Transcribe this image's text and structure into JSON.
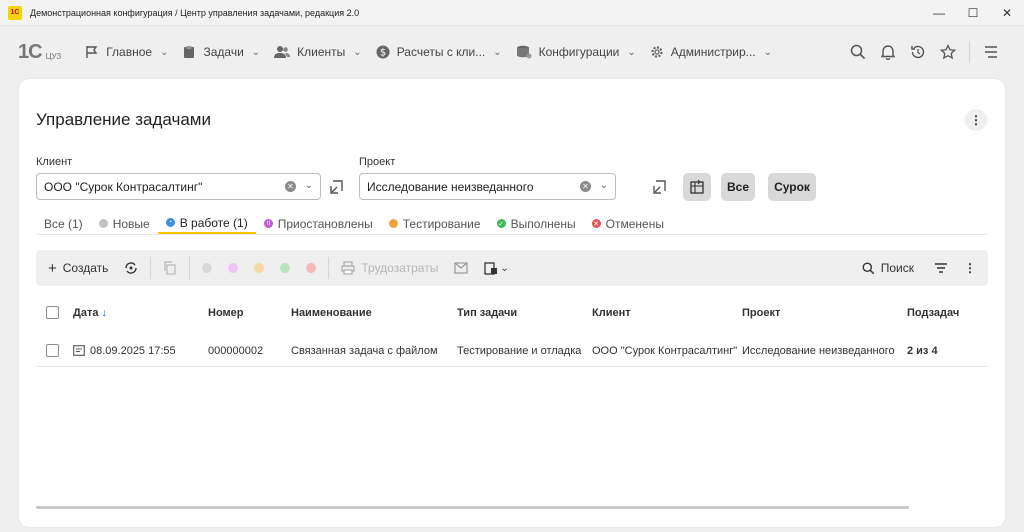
{
  "window": {
    "app_icon_text": "1С",
    "title": "Демонстрационная конфигурация / Центр управления задачами, редакция 2.0",
    "minimize": "—",
    "maximize": "☐",
    "close": "✕"
  },
  "logo": {
    "big": "1С",
    "small": "ЦУЗ"
  },
  "nav": {
    "items": [
      {
        "label": "Главное",
        "icon": "flag-icon"
      },
      {
        "label": "Задачи",
        "icon": "clipboard-icon"
      },
      {
        "label": "Клиенты",
        "icon": "users-icon"
      },
      {
        "label": "Расчеты с кли...",
        "icon": "dollar-icon"
      },
      {
        "label": "Конфигурации",
        "icon": "database-icon"
      },
      {
        "label": "Администрир...",
        "icon": "gear-icon"
      }
    ]
  },
  "page": {
    "title": "Управление задачами",
    "client_label": "Клиент",
    "client_value": "ООО \"Сурок Контрасалтинг\"",
    "project_label": "Проект",
    "project_value": "Исследование неизведанного",
    "btn_all": "Все",
    "btn_surok": "Сурок"
  },
  "tabs": [
    {
      "label": "Все (1)",
      "color": ""
    },
    {
      "label": "Новые",
      "color": "#c2c2c2"
    },
    {
      "label": "В работе (1)",
      "color": "#3d8fe0"
    },
    {
      "label": "Приостановлены",
      "color": "#c05ad6"
    },
    {
      "label": "Тестирование",
      "color": "#f2a23a"
    },
    {
      "label": "Выполнены",
      "color": "#3cba54"
    },
    {
      "label": "Отменены",
      "color": "#e05555"
    }
  ],
  "toolbar": {
    "create": "Создать",
    "effort": "Трудозатраты",
    "search": "Поиск"
  },
  "table": {
    "headers": {
      "date": "Дата",
      "sort": "↓",
      "number": "Номер",
      "name": "Наименование",
      "type": "Тип задачи",
      "client": "Клиент",
      "project": "Проект",
      "subtasks": "Подзадач"
    },
    "rows": [
      {
        "date": "08.09.2025 17:55",
        "number": "000000002",
        "name": "Связанная задача с файлом",
        "type": "Тестирование и отладка",
        "client": "ООО \"Сурок Контрасалтинг\"",
        "project": "Исследование неизведанного",
        "subtasks": "2 из 4"
      }
    ]
  }
}
